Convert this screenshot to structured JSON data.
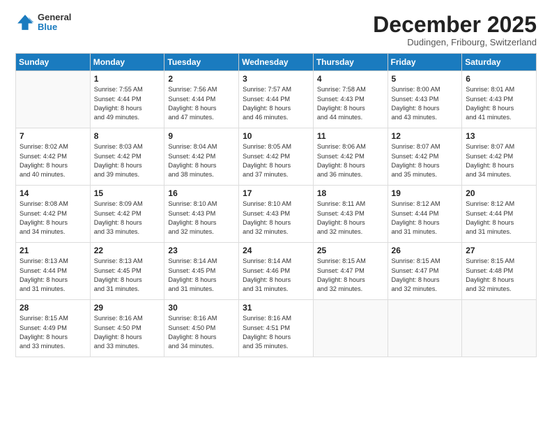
{
  "header": {
    "logo_general": "General",
    "logo_blue": "Blue",
    "title": "December 2025",
    "location": "Dudingen, Fribourg, Switzerland"
  },
  "days_of_week": [
    "Sunday",
    "Monday",
    "Tuesday",
    "Wednesday",
    "Thursday",
    "Friday",
    "Saturday"
  ],
  "weeks": [
    [
      {
        "day": "",
        "info": ""
      },
      {
        "day": "1",
        "info": "Sunrise: 7:55 AM\nSunset: 4:44 PM\nDaylight: 8 hours\nand 49 minutes."
      },
      {
        "day": "2",
        "info": "Sunrise: 7:56 AM\nSunset: 4:44 PM\nDaylight: 8 hours\nand 47 minutes."
      },
      {
        "day": "3",
        "info": "Sunrise: 7:57 AM\nSunset: 4:44 PM\nDaylight: 8 hours\nand 46 minutes."
      },
      {
        "day": "4",
        "info": "Sunrise: 7:58 AM\nSunset: 4:43 PM\nDaylight: 8 hours\nand 44 minutes."
      },
      {
        "day": "5",
        "info": "Sunrise: 8:00 AM\nSunset: 4:43 PM\nDaylight: 8 hours\nand 43 minutes."
      },
      {
        "day": "6",
        "info": "Sunrise: 8:01 AM\nSunset: 4:43 PM\nDaylight: 8 hours\nand 41 minutes."
      }
    ],
    [
      {
        "day": "7",
        "info": "Sunrise: 8:02 AM\nSunset: 4:42 PM\nDaylight: 8 hours\nand 40 minutes."
      },
      {
        "day": "8",
        "info": "Sunrise: 8:03 AM\nSunset: 4:42 PM\nDaylight: 8 hours\nand 39 minutes."
      },
      {
        "day": "9",
        "info": "Sunrise: 8:04 AM\nSunset: 4:42 PM\nDaylight: 8 hours\nand 38 minutes."
      },
      {
        "day": "10",
        "info": "Sunrise: 8:05 AM\nSunset: 4:42 PM\nDaylight: 8 hours\nand 37 minutes."
      },
      {
        "day": "11",
        "info": "Sunrise: 8:06 AM\nSunset: 4:42 PM\nDaylight: 8 hours\nand 36 minutes."
      },
      {
        "day": "12",
        "info": "Sunrise: 8:07 AM\nSunset: 4:42 PM\nDaylight: 8 hours\nand 35 minutes."
      },
      {
        "day": "13",
        "info": "Sunrise: 8:07 AM\nSunset: 4:42 PM\nDaylight: 8 hours\nand 34 minutes."
      }
    ],
    [
      {
        "day": "14",
        "info": "Sunrise: 8:08 AM\nSunset: 4:42 PM\nDaylight: 8 hours\nand 34 minutes."
      },
      {
        "day": "15",
        "info": "Sunrise: 8:09 AM\nSunset: 4:42 PM\nDaylight: 8 hours\nand 33 minutes."
      },
      {
        "day": "16",
        "info": "Sunrise: 8:10 AM\nSunset: 4:43 PM\nDaylight: 8 hours\nand 32 minutes."
      },
      {
        "day": "17",
        "info": "Sunrise: 8:10 AM\nSunset: 4:43 PM\nDaylight: 8 hours\nand 32 minutes."
      },
      {
        "day": "18",
        "info": "Sunrise: 8:11 AM\nSunset: 4:43 PM\nDaylight: 8 hours\nand 32 minutes."
      },
      {
        "day": "19",
        "info": "Sunrise: 8:12 AM\nSunset: 4:44 PM\nDaylight: 8 hours\nand 31 minutes."
      },
      {
        "day": "20",
        "info": "Sunrise: 8:12 AM\nSunset: 4:44 PM\nDaylight: 8 hours\nand 31 minutes."
      }
    ],
    [
      {
        "day": "21",
        "info": "Sunrise: 8:13 AM\nSunset: 4:44 PM\nDaylight: 8 hours\nand 31 minutes."
      },
      {
        "day": "22",
        "info": "Sunrise: 8:13 AM\nSunset: 4:45 PM\nDaylight: 8 hours\nand 31 minutes."
      },
      {
        "day": "23",
        "info": "Sunrise: 8:14 AM\nSunset: 4:45 PM\nDaylight: 8 hours\nand 31 minutes."
      },
      {
        "day": "24",
        "info": "Sunrise: 8:14 AM\nSunset: 4:46 PM\nDaylight: 8 hours\nand 31 minutes."
      },
      {
        "day": "25",
        "info": "Sunrise: 8:15 AM\nSunset: 4:47 PM\nDaylight: 8 hours\nand 32 minutes."
      },
      {
        "day": "26",
        "info": "Sunrise: 8:15 AM\nSunset: 4:47 PM\nDaylight: 8 hours\nand 32 minutes."
      },
      {
        "day": "27",
        "info": "Sunrise: 8:15 AM\nSunset: 4:48 PM\nDaylight: 8 hours\nand 32 minutes."
      }
    ],
    [
      {
        "day": "28",
        "info": "Sunrise: 8:15 AM\nSunset: 4:49 PM\nDaylight: 8 hours\nand 33 minutes."
      },
      {
        "day": "29",
        "info": "Sunrise: 8:16 AM\nSunset: 4:50 PM\nDaylight: 8 hours\nand 33 minutes."
      },
      {
        "day": "30",
        "info": "Sunrise: 8:16 AM\nSunset: 4:50 PM\nDaylight: 8 hours\nand 34 minutes."
      },
      {
        "day": "31",
        "info": "Sunrise: 8:16 AM\nSunset: 4:51 PM\nDaylight: 8 hours\nand 35 minutes."
      },
      {
        "day": "",
        "info": ""
      },
      {
        "day": "",
        "info": ""
      },
      {
        "day": "",
        "info": ""
      }
    ]
  ]
}
